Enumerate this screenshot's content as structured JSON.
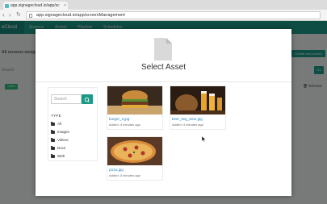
{
  "browser": {
    "tab_title": "app.signagecloud.io/app/sc",
    "tab_close": "×",
    "back": "‹",
    "forward": "›",
    "reload": "↻",
    "url": "app.signagecloud.io/app/screenManagement"
  },
  "app": {
    "brand": "eCloud",
    "nav": [
      "Screens",
      "Assets",
      "Playlists",
      "Schedules"
    ],
    "list_title": "All screens assign",
    "create_button": "Create new screen",
    "search_placeholder": "Search",
    "go_button": "Go",
    "status_badge": "Online",
    "remove_label": "Remove",
    "accent": "#1d9a86"
  },
  "modal": {
    "title": "Select Asset",
    "search_placeholder": "Search",
    "type_label": "TYPE",
    "types": [
      "All",
      "Images",
      "Videos",
      "Docs",
      "Web"
    ],
    "assets": [
      {
        "name": "burger_2.jpg",
        "added": "Added: 4 minutes ago",
        "image": "burger"
      },
      {
        "name": "beer_keg_wine.jpg",
        "added": "Added: 4 minutes ago",
        "image": "beer-and-wine"
      },
      {
        "name": "pizza.jpg",
        "added": "Added: 3 minutes ago",
        "image": "pizza"
      }
    ]
  }
}
